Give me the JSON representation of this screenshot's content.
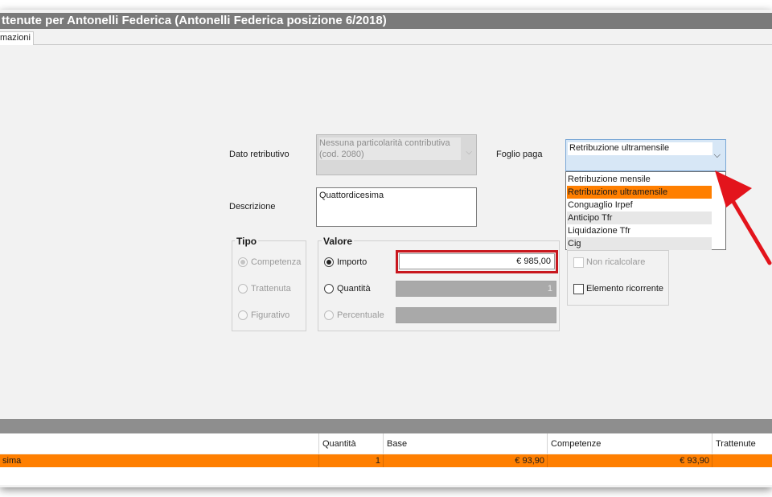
{
  "window": {
    "title": "ttenute per Antonelli Federica (Antonelli Federica posizione 6/2018)",
    "tab_label": "mazioni"
  },
  "form": {
    "dato_retributivo_label": "Dato retributivo",
    "dato_retributivo_value": "Nessuna particolarità contributiva (cod. 2080)",
    "descrizione_label": "Descrizione",
    "descrizione_value": "Quattordicesima",
    "foglio_paga_label": "Foglio paga",
    "foglio_paga_value": "Retribuzione ultramensile",
    "foglio_paga_options": [
      "Retribuzione mensile",
      "Retribuzione ultramensile",
      "Conguaglio Irpef",
      "Anticipo Tfr",
      "Liquidazione Tfr",
      "Cig"
    ],
    "foglio_paga_selected_index": 1
  },
  "tipo": {
    "title": "Tipo",
    "options": [
      "Competenza",
      "Trattenuta",
      "Figurativo"
    ],
    "selected": "Competenza"
  },
  "valore": {
    "title": "Valore",
    "importo_label": "Importo",
    "importo_value": "€ 985,00",
    "quantita_label": "Quantità",
    "quantita_value": "1",
    "percentuale_label": "Percentuale",
    "percentuale_value": "",
    "selected": "Importo"
  },
  "options_panel": {
    "non_ricalcolare_label": "Non ricalcolare",
    "elemento_ricorrente_label": "Elemento ricorrente",
    "non_ricalcolare_checked": false,
    "elemento_ricorrente_checked": false
  },
  "grid": {
    "columns": [
      "Quantità",
      "Base",
      "Competenze",
      "Trattenute"
    ],
    "rows": [
      {
        "desc": "sima",
        "quantita": "1",
        "base": "€ 93,90",
        "competenze": "€ 93,90",
        "trattenute": ""
      }
    ]
  },
  "colors": {
    "selection": "#ff7f00",
    "highlight_box": "#c8171e",
    "arrow": "#e3141c",
    "titlebar": "#7a7a7a"
  }
}
